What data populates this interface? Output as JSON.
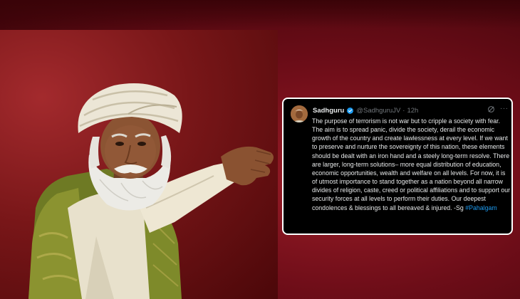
{
  "colors": {
    "background": "#6a0a15",
    "card_background": "#000000",
    "card_border": "#ffffff",
    "text_primary": "#e7e9ea",
    "text_secondary": "#71767b",
    "link": "#1d9bf0",
    "verified_badge": "#1d9bf0"
  },
  "photo": {
    "subject_icon": "person-with-turban-photo"
  },
  "tweet": {
    "author_name": "Sadhguru",
    "verified_icon": "verified-badge-icon",
    "handle": "@SadhguruJV",
    "separator": "·",
    "time": "12h",
    "grok_icon": "grok-icon",
    "more_icon": "more-options-icon",
    "more_glyph": "···",
    "body": "The purpose of terrorism is not war but to cripple a society with fear. The aim is to spread panic, divide the society, derail the economic growth of the country and create lawlessness at every level. If we want to preserve and nurture the sovereignty of this nation, these elements should be dealt with an iron hand and a steely long-term resolve. There are larger, long-term solutions– more equal distribution of education, economic opportunities, wealth and welfare on all levels. For now, it is of utmost importance to stand together as a nation beyond all narrow divides of religion, caste, creed or political affiliations and to support our security forces at all levels to perform their duties. Our deepest condolences & blessings to all bereaved & injured. -Sg",
    "hashtag": "#Pahalgam"
  }
}
